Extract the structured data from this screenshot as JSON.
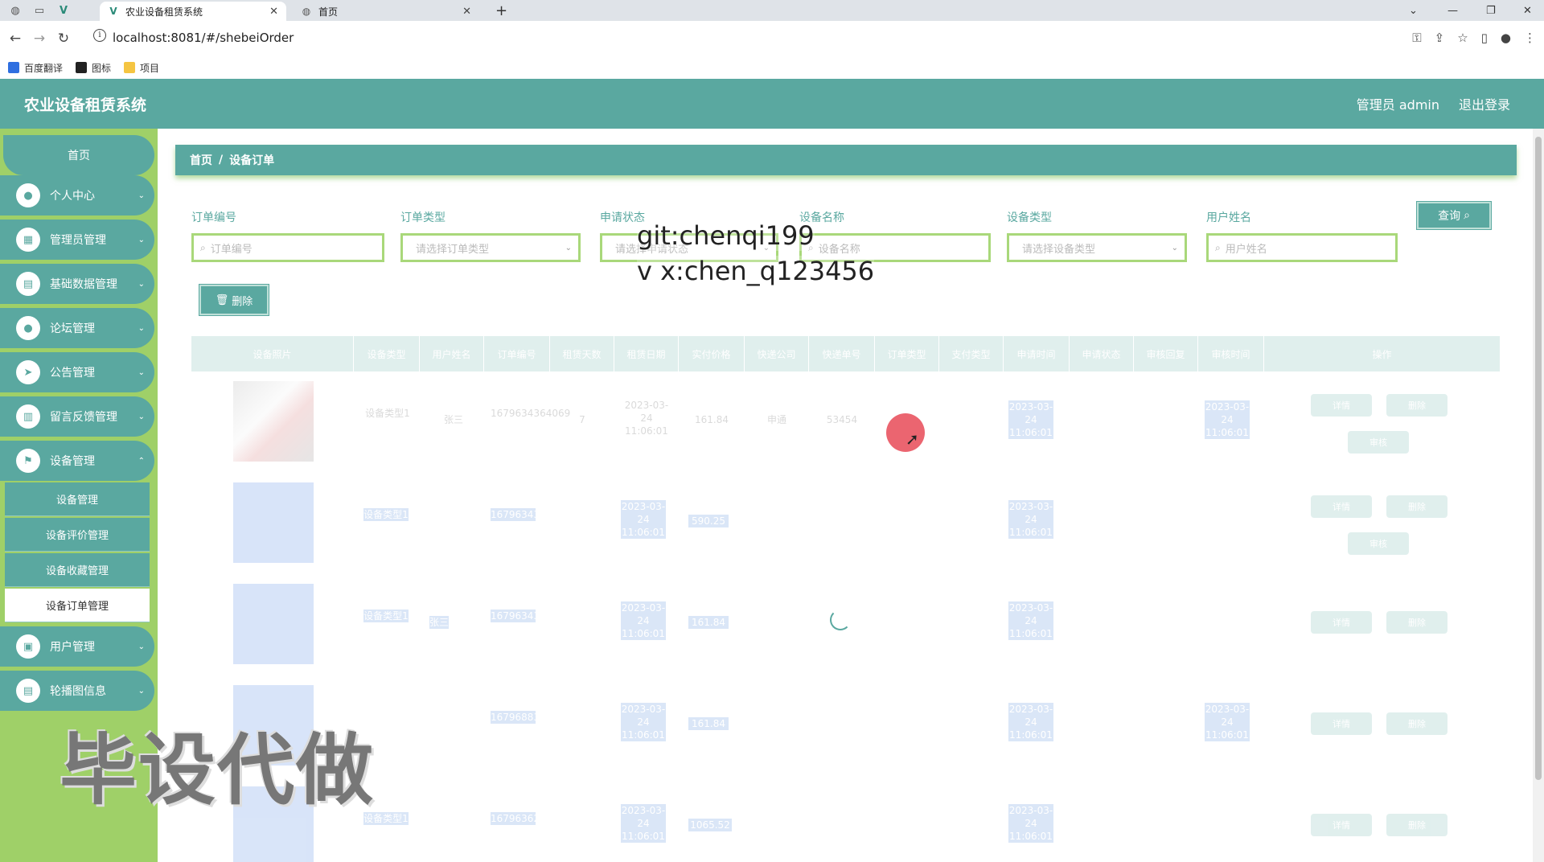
{
  "browser": {
    "tabs": [
      {
        "title": "农业设备租赁系统",
        "active": true
      },
      {
        "title": "首页",
        "active": false
      }
    ],
    "url": "localhost:8081/#/shebeiOrder",
    "bookmarks": [
      "百度翻译",
      "图标",
      "项目"
    ]
  },
  "header": {
    "title": "农业设备租赁系统",
    "user": "管理员 admin",
    "logout": "退出登录",
    "color": "#5aa8a0"
  },
  "sidebar": {
    "home": "首页",
    "items": [
      {
        "label": "个人中心",
        "icon": "person-icon"
      },
      {
        "label": "管理员管理",
        "icon": "grid-icon"
      },
      {
        "label": "基础数据管理",
        "icon": "chart-icon"
      },
      {
        "label": "论坛管理",
        "icon": "person-icon"
      },
      {
        "label": "公告管理",
        "icon": "send-icon"
      },
      {
        "label": "留言反馈管理",
        "icon": "board-icon"
      },
      {
        "label": "设备管理",
        "icon": "flag-icon"
      },
      {
        "label": "用户管理",
        "icon": "lock-icon"
      },
      {
        "label": "轮播图信息",
        "icon": "clipboard-icon"
      }
    ],
    "submenu": [
      "设备管理",
      "设备评价管理",
      "设备收藏管理",
      "设备订单管理"
    ],
    "active_submenu": "设备订单管理",
    "bg_color": "#9fd068"
  },
  "watermark": "毕设代做",
  "overlay": {
    "line1": "git:chenqi199",
    "line2": "v x:chen_q123456"
  },
  "breadcrumb": {
    "home": "首页",
    "current": "设备订单"
  },
  "filters": [
    {
      "label": "订单编号",
      "placeholder": "订单编号",
      "type": "input"
    },
    {
      "label": "订单类型",
      "placeholder": "请选择订单类型",
      "type": "select"
    },
    {
      "label": "申请状态",
      "placeholder": "请选择申请状态",
      "type": "select"
    },
    {
      "label": "设备名称",
      "placeholder": "设备名称",
      "type": "input"
    },
    {
      "label": "设备类型",
      "placeholder": "请选择设备类型",
      "type": "select"
    },
    {
      "label": "用户姓名",
      "placeholder": "用户姓名",
      "type": "input"
    }
  ],
  "buttons": {
    "query": "查询",
    "delete": "删除"
  },
  "table": {
    "columns": [
      "设备照片",
      "设备类型",
      "用户姓名",
      "订单编号",
      "租赁天数",
      "租赁日期",
      "实付价格",
      "快递公司",
      "快递单号",
      "订单类型",
      "支付类型",
      "申请时间",
      "申请状态",
      "审核回复",
      "审核时间",
      "操作"
    ],
    "rows": [
      {
        "type": "设备类型1",
        "user": "张三",
        "order_no": "1679634364069",
        "days": "7",
        "date": "2023-03-24 11:06:01",
        "price": "161.84",
        "express": "申通",
        "express_no": "53454",
        "order_type": "",
        "pay": "",
        "apply_time": "2023-03-24 11:06:01",
        "status": "",
        "reply": "",
        "review_time": "2023-03-24 11:06:01"
      },
      {
        "type": "设备类型1",
        "user": "",
        "order_no": "1679634364111",
        "days": "",
        "date": "2023-03-24 11:06:01",
        "price": "590.25",
        "express": "",
        "express_no": "",
        "order_type": "",
        "pay": "",
        "apply_time": "2023-03-24 11:06:01",
        "status": "",
        "reply": "",
        "review_time": ""
      },
      {
        "type": "设备类型1",
        "user": "张三",
        "order_no": "1679634362879",
        "days": "",
        "date": "2023-03-24 11:06:01",
        "price": "161.84",
        "express": "",
        "express_no": "",
        "order_type": "",
        "pay": "",
        "apply_time": "2023-03-24 11:06:01",
        "status": "",
        "reply": "",
        "review_time": ""
      },
      {
        "type": "",
        "user": "",
        "order_no": "1679688371977",
        "days": "",
        "date": "2023-03-24 11:06:01",
        "price": "161.84",
        "express": "",
        "express_no": "",
        "order_type": "",
        "pay": "",
        "apply_time": "2023-03-24 11:06:01",
        "status": "",
        "reply": "",
        "review_time": "2023-03-24 11:06:01"
      },
      {
        "type": "设备类型1",
        "user": "",
        "order_no": "1679636242155",
        "days": "",
        "date": "2023-03-24 11:06:01",
        "price": "1065.52",
        "express": "",
        "express_no": "",
        "order_type": "",
        "pay": "",
        "apply_time": "2023-03-24 11:06:01",
        "status": "",
        "reply": "",
        "review_time": ""
      }
    ],
    "row_actions": [
      "详情",
      "删除",
      "审核"
    ]
  }
}
